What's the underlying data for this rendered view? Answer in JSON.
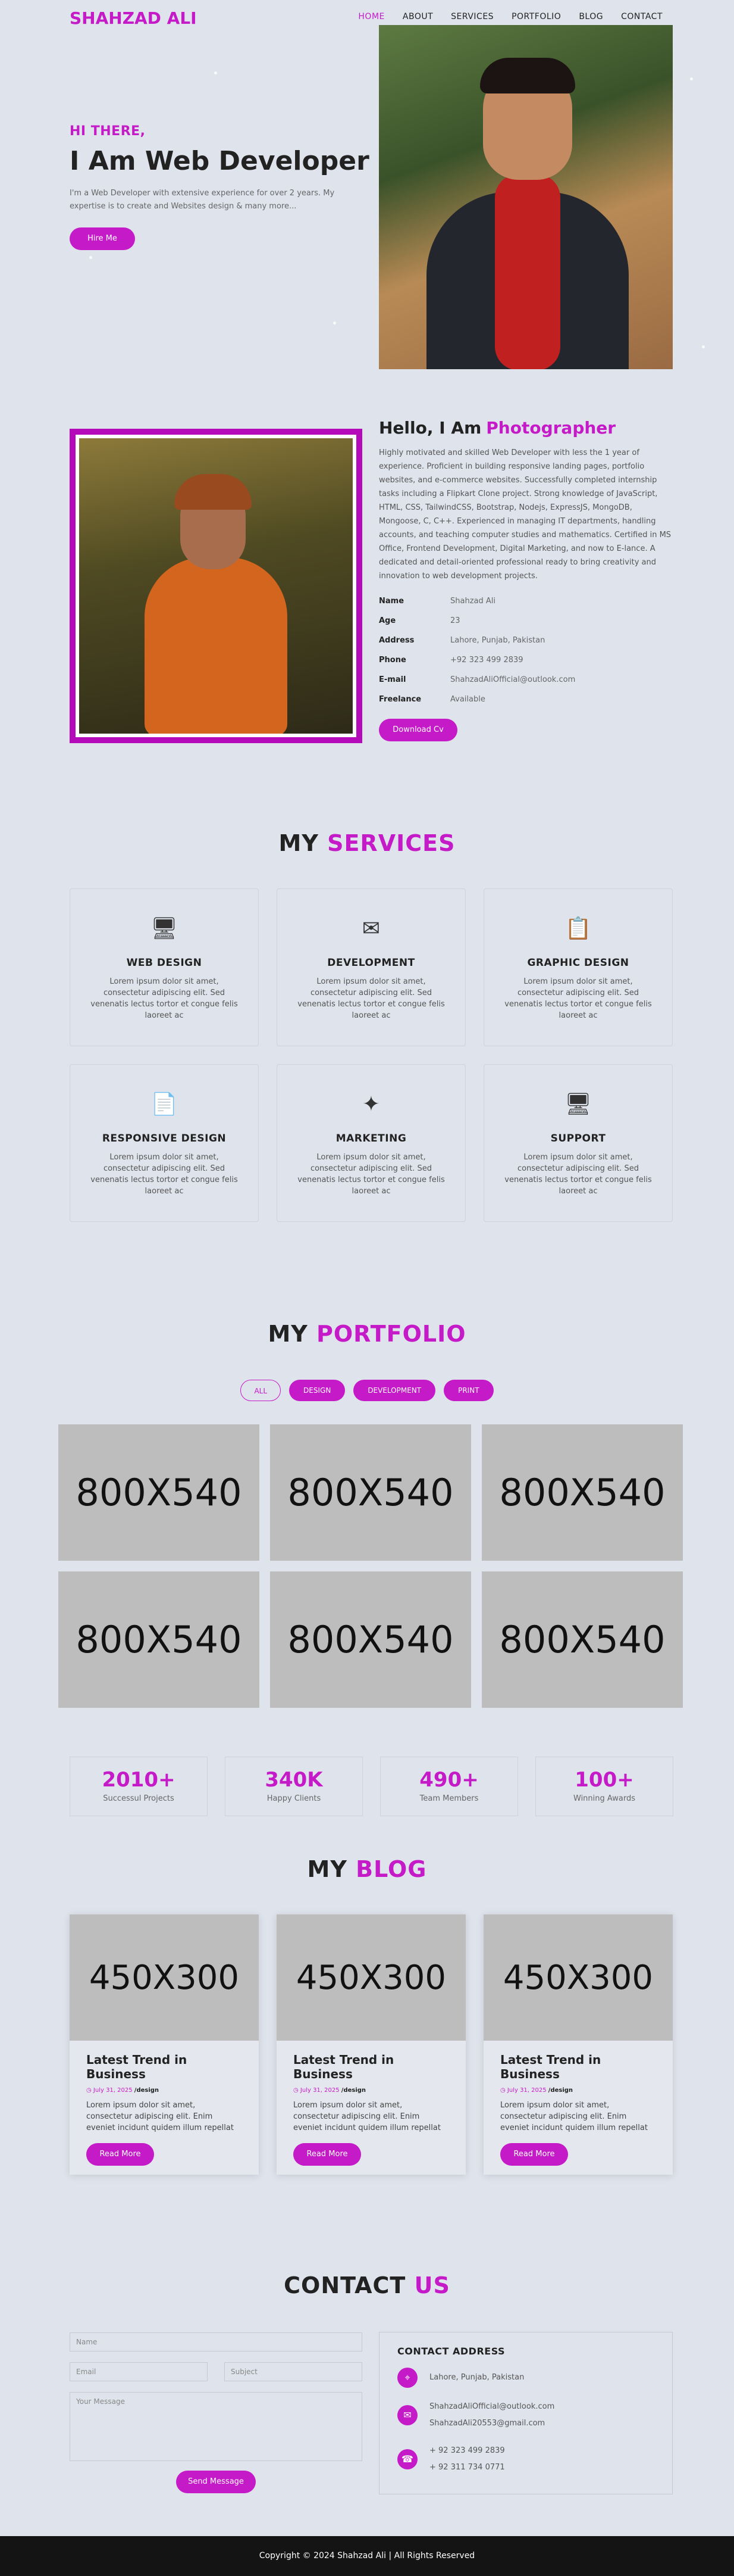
{
  "nav": {
    "brand": "SHAHZAD ALI",
    "items": [
      "HOME",
      "ABOUT",
      "SERVICES",
      "PORTFOLIO",
      "BLOG",
      "CONTACT"
    ]
  },
  "hero": {
    "greeting": "HI THERE,",
    "headline": "I Am Web Developer",
    "description": "I'm a Web Developer with extensive experience for over 2 years. My expertise is to create and Websites design & many more...",
    "cta": "Hire Me"
  },
  "about": {
    "title_prefix": "Hello, I Am",
    "title_role": "Photographer",
    "description": "Highly motivated and skilled Web Developer with less the 1 year of experience. Proficient in building responsive landing pages, portfolio websites, and e-commerce websites. Successfully completed internship tasks including a Flipkart Clone project. Strong knowledge of JavaScript, HTML, CSS, TailwindCSS, Bootstrap, Nodejs, ExpressJS, MongoDB, Mongoose, C, C++. Experienced in managing IT departments, handling accounts, and teaching computer studies and mathematics. Certified in MS Office, Frontend Development, Digital Marketing, and now to E-lance. A dedicated and detail-oriented professional ready to bring creativity and innovation to web development projects.",
    "info": [
      {
        "key": "Name",
        "value": "Shahzad Ali"
      },
      {
        "key": "Age",
        "value": "23"
      },
      {
        "key": "Address",
        "value": "Lahore, Punjab, Pakistan"
      },
      {
        "key": "Phone",
        "value": "+92 323 499 2839"
      },
      {
        "key": "E-mail",
        "value": "ShahzadAliOfficial@outlook.com"
      },
      {
        "key": "Freelance",
        "value": "Available"
      }
    ],
    "cta": "Download Cv"
  },
  "services": {
    "title_a": "MY",
    "title_b": "SERVICES",
    "items": [
      {
        "name": "WEB DESIGN",
        "icon": "monitor-icon",
        "glyph": "🖥",
        "desc": "Lorem ipsum dolor sit amet, consectetur adipiscing elit. Sed venenatis lectus tortor et congue felis laoreet ac"
      },
      {
        "name": "DEVELOPMENT",
        "icon": "envelope-icon",
        "glyph": "✉",
        "desc": "Lorem ipsum dolor sit amet, consectetur adipiscing elit. Sed venenatis lectus tortor et congue felis laoreet ac"
      },
      {
        "name": "GRAPHIC DESIGN",
        "icon": "clipboard-icon",
        "glyph": "📋",
        "desc": "Lorem ipsum dolor sit amet, consectetur adipiscing elit. Sed venenatis lectus tortor et congue felis laoreet ac"
      },
      {
        "name": "RESPONSIVE DESIGN",
        "icon": "document-icon",
        "glyph": "📄",
        "desc": "Lorem ipsum dolor sit amet, consectetur adipiscing elit. Sed venenatis lectus tortor et congue felis laoreet ac"
      },
      {
        "name": "MARKETING",
        "icon": "sparkle-icon",
        "glyph": "✦",
        "desc": "Lorem ipsum dolor sit amet, consectetur adipiscing elit. Sed venenatis lectus tortor et congue felis laoreet ac"
      },
      {
        "name": "SUPPORT",
        "icon": "monitor-icon",
        "glyph": "🖥",
        "desc": "Lorem ipsum dolor sit amet, consectetur adipiscing elit. Sed venenatis lectus tortor et congue felis laoreet ac"
      }
    ]
  },
  "portfolio": {
    "title_a": "MY",
    "title_b": "PORTFOLIO",
    "filters": [
      "ALL",
      "DESIGN",
      "DEVELOPMENT",
      "PRINT"
    ],
    "items": [
      "800X540",
      "800X540",
      "800X540",
      "800X540",
      "800X540",
      "800X540"
    ]
  },
  "stats": [
    {
      "num": "2010+",
      "label": "Successul Projects"
    },
    {
      "num": "340K",
      "label": "Happy Clients"
    },
    {
      "num": "490+",
      "label": "Team Members"
    },
    {
      "num": "100+",
      "label": "Winning Awards"
    }
  ],
  "blog": {
    "title_a": "MY",
    "title_b": "BLOG",
    "posts": [
      {
        "image": "450X300",
        "title": "Latest Trend in Business",
        "date": "July 31, 2025",
        "category": "/design",
        "desc": "Lorem ipsum dolor sit amet, consectetur adipiscing elit. Enim eveniet incidunt quidem illum repellat",
        "cta": "Read More"
      },
      {
        "image": "450X300",
        "title": "Latest Trend in Business",
        "date": "July 31, 2025",
        "category": "/design",
        "desc": "Lorem ipsum dolor sit amet, consectetur adipiscing elit. Enim eveniet incidunt quidem illum repellat",
        "cta": "Read More"
      },
      {
        "image": "450X300",
        "title": "Latest Trend in Business",
        "date": "July 31, 2025",
        "category": "/design",
        "desc": "Lorem ipsum dolor sit amet, consectetur adipiscing elit. Enim eveniet incidunt quidem illum repellat",
        "cta": "Read More"
      }
    ]
  },
  "contact": {
    "title_a": "CONTACT",
    "title_b": "US",
    "form": {
      "name_placeholder": "Name",
      "email_placeholder": "Email",
      "subject_placeholder": "Subject",
      "message_placeholder": "Your Message",
      "submit": "Send Message"
    },
    "box": {
      "title": "CONTACT ADDRESS",
      "address": "Lahore, Punjab, Pakistan",
      "email1": "ShahzadAliOfficial@outlook.com",
      "email2": "ShahzadAli20553@gmail.com",
      "phone1": "+ 92 323 499 2839",
      "phone2": "+ 92 311 734 0771"
    }
  },
  "footer": {
    "text": "Copyright © 2024 Shahzad Ali | All Rights Reserved"
  },
  "colors": {
    "accent": "#c51ac7",
    "background": "#dfe3ec",
    "footer": "#141414"
  }
}
